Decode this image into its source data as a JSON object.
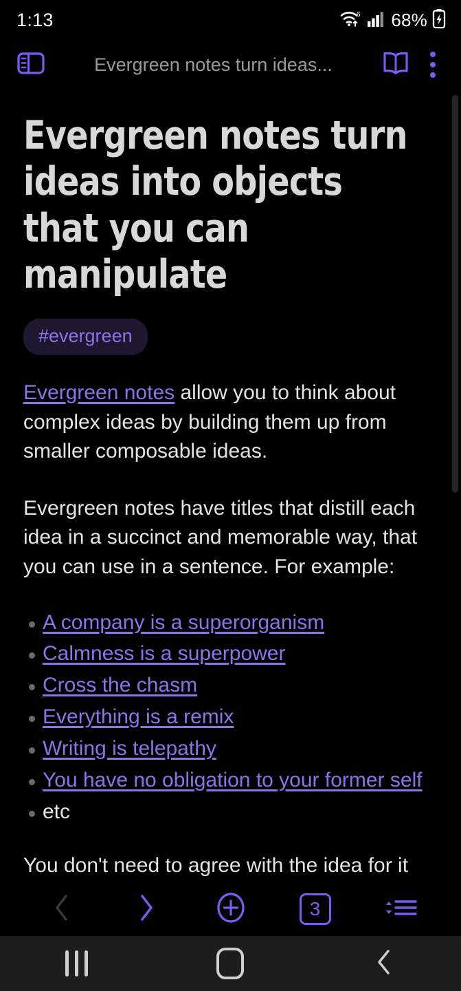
{
  "statusbar": {
    "time": "1:13",
    "battery_percent": "68%",
    "icons": [
      "wifi-6-icon",
      "cellular-signal-icon",
      "battery-charging-icon"
    ]
  },
  "appbar": {
    "tab_title": "Evergreen notes turn ideas...",
    "sidebar_toggle": "sidebar-panel-icon",
    "reader_mode": "open-book-icon",
    "overflow_menu": "three-dot-menu-icon"
  },
  "page": {
    "title": "Evergreen notes turn ideas into objects that you can manipulate",
    "tag": "#evergreen",
    "paragraph1_link": "Evergreen notes",
    "paragraph1_rest": " allow you to think about complex ideas by building them up from smaller composable ideas.",
    "paragraph2": "Evergreen notes have titles that distill each idea in a succinct and memorable way, that you can use in a sentence. For example:",
    "examples": [
      {
        "label": "A company is a superorganism",
        "is_link": true
      },
      {
        "label": "Calmness is a superpower",
        "is_link": true
      },
      {
        "label": "Cross the chasm",
        "is_link": true
      },
      {
        "label": "Everything is a remix",
        "is_link": true
      },
      {
        "label": "Writing is telepathy",
        "is_link": true
      },
      {
        "label": "You have no obligation to your former self",
        "is_link": true
      },
      {
        "label": "etc",
        "is_link": false
      }
    ],
    "clipped_paragraph": "You don't need to agree with the idea for it"
  },
  "browser_toolbar": {
    "back": "chevron-left-icon",
    "forward": "chevron-right-icon",
    "new_tab": "plus-circle-icon",
    "tab_count": "3",
    "menu": "sort-menu-icon"
  },
  "navbar": {
    "recents": "recent-apps-icon",
    "home": "home-icon",
    "back": "back-icon"
  },
  "colors": {
    "accent_purple": "#7c5cf0",
    "link_purple": "#8a74e8",
    "tag_bg": "#1d1830",
    "background": "#000000",
    "navbar_bg": "#1d1d1d",
    "disabled_gray": "#3a3a3a"
  }
}
